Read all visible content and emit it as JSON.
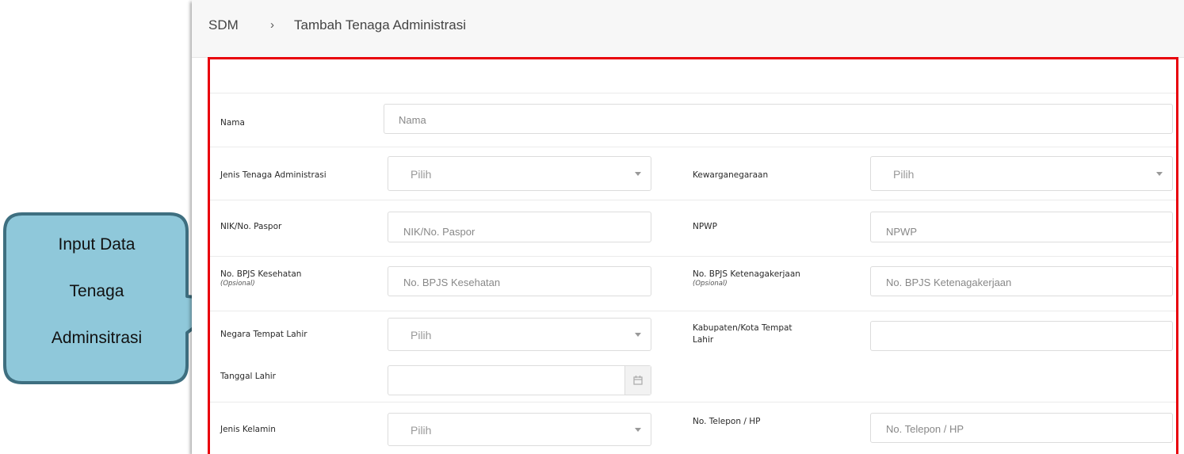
{
  "breadcrumb": {
    "root": "SDM",
    "separator": "›",
    "current": "Tambah Tenaga Administrasi"
  },
  "form": {
    "nama": {
      "label": "Nama",
      "placeholder": "Nama"
    },
    "jenis_tenaga": {
      "label": "Jenis Tenaga Administrasi",
      "value": "Pilih"
    },
    "kewarganegaraan": {
      "label": "Kewarganegaraan",
      "value": "Pilih"
    },
    "nik": {
      "label": "NIK/No. Paspor",
      "placeholder": "NIK/No. Paspor"
    },
    "npwp": {
      "label": "NPWP",
      "placeholder": "NPWP"
    },
    "bpjs_kesehatan": {
      "label": "No. BPJS Kesehatan",
      "note": "(Opsional)",
      "placeholder": "No. BPJS Kesehatan"
    },
    "bpjs_ketenagakerjaan": {
      "label": "No. BPJS Ketenagakerjaan",
      "note": "(Opsional)",
      "placeholder": "No. BPJS Ketenagakerjaan"
    },
    "negara_lahir": {
      "label": "Negara Tempat Lahir",
      "value": "Pilih"
    },
    "kota_lahir": {
      "label_line1": "Kabupaten/Kota Tempat",
      "label_line2": "Lahir",
      "value": ""
    },
    "tanggal_lahir": {
      "label": "Tanggal Lahir",
      "value": ""
    },
    "jenis_kelamin": {
      "label": "Jenis Kelamin",
      "value": "Pilih"
    },
    "telepon": {
      "label": "No. Telepon / HP",
      "placeholder": "No. Telepon / HP"
    }
  },
  "callout": {
    "line1": "Input Data",
    "line2": "Tenaga",
    "line3": "Adminsitrasi",
    "fill_color": "#8fc8da",
    "border_color": "#3e6f80"
  },
  "colors": {
    "highlight_border": "#e8000b"
  },
  "icons": {
    "dropdown": "caret-down-icon",
    "calendar": "calendar-icon"
  }
}
